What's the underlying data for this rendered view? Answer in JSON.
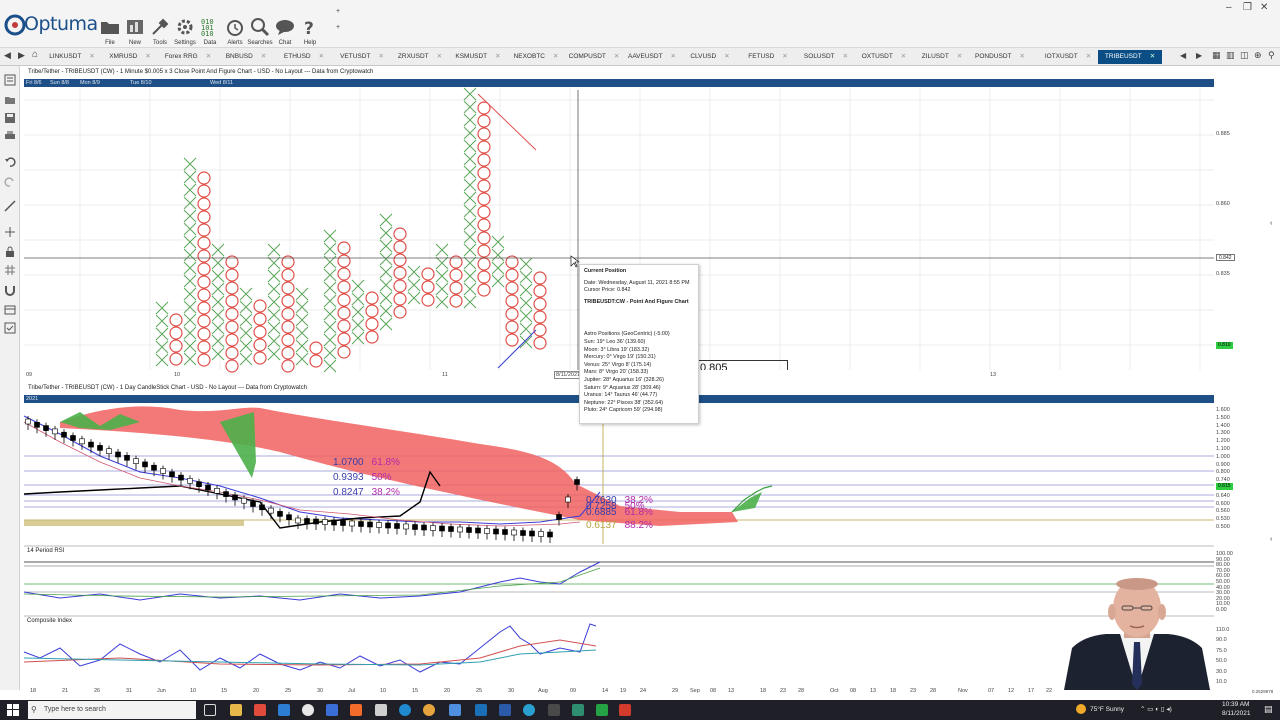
{
  "app": {
    "name": "Optuma"
  },
  "toolbar": {
    "buttons": [
      {
        "label": "File",
        "icon": "folder-icon"
      },
      {
        "label": "New",
        "icon": "new-chart-icon"
      },
      {
        "label": "Tools",
        "icon": "tools-icon"
      },
      {
        "label": "Settings",
        "icon": "gear-icon"
      },
      {
        "label": "Data",
        "icon": "data-icon"
      },
      {
        "label": "Alerts",
        "icon": "alarm-clock-icon"
      },
      {
        "label": "Searches",
        "icon": "search-icon"
      },
      {
        "label": "Chat",
        "icon": "chat-icon"
      },
      {
        "label": "Help",
        "icon": "help-icon"
      }
    ]
  },
  "tabs": [
    "LINKUSDT",
    "XMRUSD",
    "Forex RRG",
    "BNBUSD",
    "ETHUSD",
    "VETUSDT",
    "ZRXUSDT",
    "KSMUSDT",
    "NEXOBTC",
    "COMPUSDT",
    "AAVEUSDT",
    "CLVUSD",
    "FETUSD",
    "SOLUSDT",
    "OXTUSDT",
    "ZILUSDT",
    "PONDUSDT",
    "IOTXUSDT",
    "TRIBEUSDT"
  ],
  "top_chart": {
    "title": "Tribe/Tether - TRIBEUSDT (CW) - 1 Minute $0.005 x 3 Close Point And Figure Chart - USD - No Layout --- Data from Cryptowatch",
    "date_labels": [
      "Fri 8/6",
      "Sun 8/8",
      "Mon 8/9",
      "Tue 8/10",
      "Wed 8/11"
    ],
    "x_labels": [
      "09",
      "10",
      "11",
      "13"
    ],
    "y_labels": [
      "0.885",
      "0.860",
      "0.835"
    ],
    "cursor_price": "0.842",
    "last_price": "0.810",
    "cursor_date": "8/11/2021",
    "partial_box": "0.805"
  },
  "tooltip": {
    "heading": "Current Position",
    "date": "Date: Wednesday, August 11, 2021 8:55 PM",
    "cursor_price": "Cursor Price: 0.842",
    "chart_name": "TRIBEUSDT:CW - Point And Figure Chart",
    "astro_heading": "Astro Positions (GeoCentric) (-5:00)",
    "astro": [
      "Sun: 19° Leo 36' (139.60)",
      "Moon: 3° Libra 19' (183.32)",
      "Mercury: 0° Virgo 19' (150.31)",
      "Venus: 25° Virgo 8' (175.14)",
      "Mars: 8° Virgo 20' (158.33)",
      "Jupiter: 28° Aquarius 16' (328.26)",
      "Saturn: 9° Aquarius 28' (309.46)",
      "Uranus: 14° Taurus 46' (44.77)",
      "Neptune: 22° Pisces 38' (352.64)",
      "Pluto: 24° Capricorn 59' (294.98)"
    ]
  },
  "bottom_chart": {
    "title": "Tribe/Tether - TRIBEUSDT (CW) - 1 Day CandleStick Chart - USD - No Layout --- Data from Cryptowatch",
    "year_label": "2021",
    "y_labels": [
      "1.600",
      "1.500",
      "1.400",
      "1.300",
      "1.200",
      "1.100",
      "1.000",
      "0.900",
      "0.800",
      "0.740",
      "0.700",
      "0.640",
      "0.600",
      "0.560",
      "0.530",
      "0.500"
    ],
    "last_price": "0.815",
    "fib_upper": [
      {
        "value": "1.0700",
        "pct": "61.8%"
      },
      {
        "value": "0.9393",
        "pct": "50%"
      },
      {
        "value": "0.8247",
        "pct": "38.2%"
      }
    ],
    "fib_lower": [
      {
        "value": "0.7630",
        "pct": "38.2%"
      },
      {
        "value": "0.7258",
        "pct": "50%"
      },
      {
        "value": "0.6885",
        "pct": "61.8%"
      },
      {
        "value": "0.6137",
        "pct": "88.2%"
      }
    ],
    "rsi_title": "14 Period RSI",
    "rsi_labels": [
      "100.00",
      "90.00",
      "80.00",
      "70.00",
      "60.00",
      "50.00",
      "40.00",
      "30.00",
      "20.00",
      "10.00",
      "0.00"
    ],
    "ci_title": "Composite Index",
    "ci_labels": [
      "110.0",
      "90.0",
      "75.0",
      "50.0",
      "30.0",
      "10.0"
    ],
    "x_labels": [
      "18",
      "21",
      "26",
      "31",
      "Jun",
      "10",
      "15",
      "20",
      "25",
      "30",
      "Jul",
      "10",
      "15",
      "20",
      "25",
      "30",
      "Aug",
      "09",
      "14",
      "19",
      "24",
      "29",
      "Sep",
      "08",
      "13",
      "18",
      "23",
      "28",
      "Oct",
      "08",
      "13",
      "18",
      "23",
      "28",
      "Nov",
      "07",
      "12",
      "17",
      "22"
    ],
    "corner_value": "0.2529978"
  },
  "taskbar": {
    "search_placeholder": "Type here to search",
    "weather": "75°F  Sunny",
    "time": "10:39 AM",
    "date": "8/11/2021"
  },
  "colors": {
    "brand": "#1b4f8a",
    "cloud_red": "#f0615f",
    "cloud_green": "#4bb04a",
    "pnf_x": "#5aa65a",
    "pnf_o": "#e0504a",
    "fib_text": "#3b3ba8"
  }
}
